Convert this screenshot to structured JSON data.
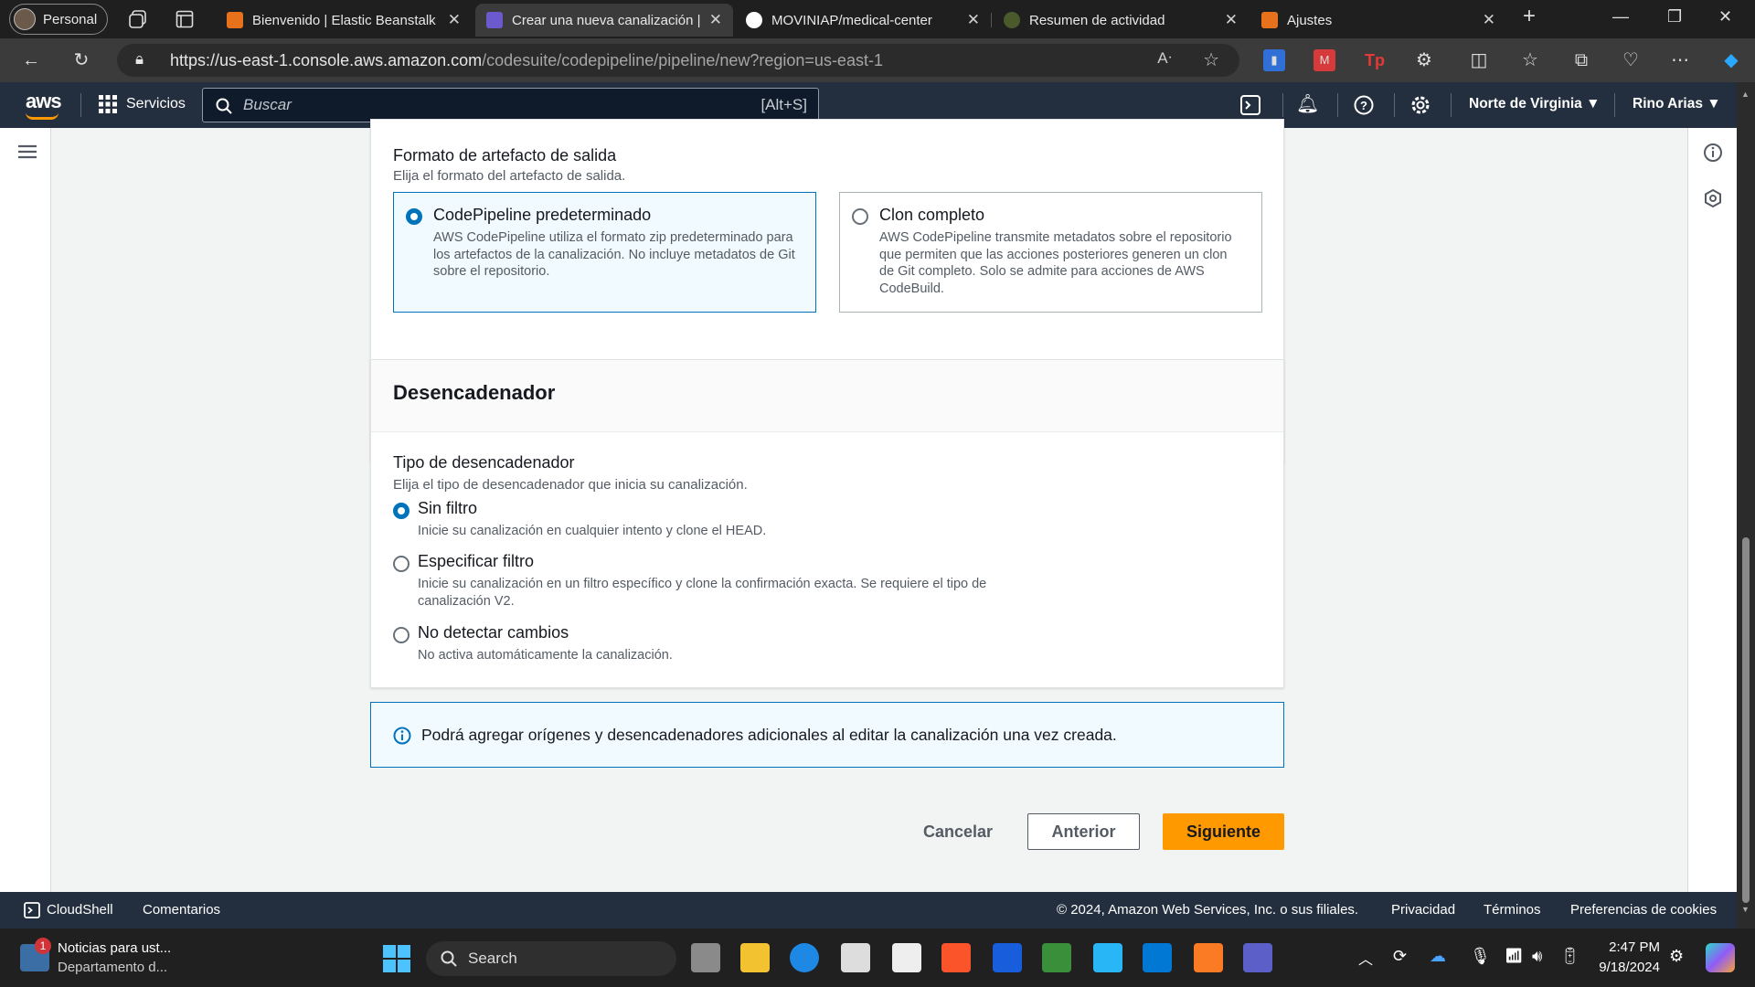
{
  "browser": {
    "profile": "Personal",
    "tabs": [
      {
        "title": "Bienvenido | Elastic Beanstalk |",
        "color": "#e8721c"
      },
      {
        "title": "Crear una nueva canalización |",
        "color": "#6a5acd"
      },
      {
        "title": "MOVINIAP/medical-center",
        "color": "#ffffff"
      },
      {
        "title": "Resumen de actividad",
        "color": "#4a5a2a"
      },
      {
        "title": "Ajustes",
        "color": "#e8721c"
      }
    ],
    "url_host": "https://us-east-1.console.aws.amazon.com",
    "url_path": "/codesuite/codepipeline/pipeline/new?region=us-east-1"
  },
  "aws_nav": {
    "logo": "aws",
    "services": "Servicios",
    "search_placeholder": "Buscar",
    "search_shortcut": "[Alt+S]",
    "region": "Norte de Virginia",
    "user": "Rino Arias"
  },
  "artifact": {
    "label": "Formato de artefacto de salida",
    "description": "Elija el formato del artefacto de salida.",
    "options": [
      {
        "title": "CodePipeline predeterminado",
        "text": "AWS CodePipeline utiliza el formato zip predeterminado para los artefactos de la canalización. No incluye metadatos de Git sobre el repositorio.",
        "selected": true
      },
      {
        "title": "Clon completo",
        "text": "AWS CodePipeline transmite metadatos sobre el repositorio que permiten que las acciones posteriores generen un clon de Git completo. Solo se admite para acciones de AWS CodeBuild.",
        "selected": false
      }
    ]
  },
  "trigger": {
    "heading": "Desencadenador",
    "label": "Tipo de desencadenador",
    "description": "Elija el tipo de desencadenador que inicia su canalización.",
    "options": [
      {
        "title": "Sin filtro",
        "text": "Inicie su canalización en cualquier intento y clone el HEAD.",
        "selected": true
      },
      {
        "title": "Especificar filtro",
        "text": "Inicie su canalización en un filtro específico y clone la confirmación exacta. Se requiere el tipo de canalización V2.",
        "selected": false
      },
      {
        "title": "No detectar cambios",
        "text": "No activa automáticamente la canalización.",
        "selected": false
      }
    ]
  },
  "info_alert": "Podrá agregar orígenes y desencadenadores adicionales al editar la canalización una vez creada.",
  "actions": {
    "cancel": "Cancelar",
    "previous": "Anterior",
    "next": "Siguiente"
  },
  "footer": {
    "cloudshell": "CloudShell",
    "feedback": "Comentarios",
    "copyright": "© 2024, Amazon Web Services, Inc. o sus filiales.",
    "privacy": "Privacidad",
    "terms": "Términos",
    "cookies": "Preferencias de cookies"
  },
  "taskbar": {
    "news_badge": "1",
    "news_title": "Noticias para ust...",
    "news_sub": "Departamento d...",
    "search": "Search",
    "time": "2:47 PM",
    "date": "9/18/2024"
  },
  "colors": {
    "primary_button": "#ff9900",
    "aws_nav_bg": "#232f3e",
    "selected_border": "#0073bb"
  }
}
